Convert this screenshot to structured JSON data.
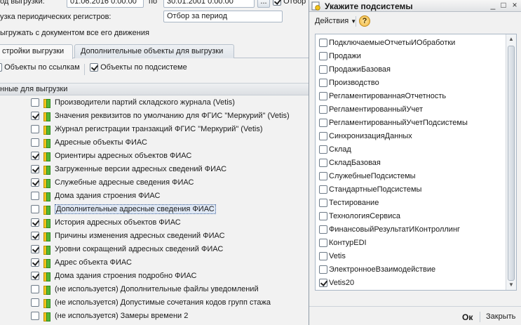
{
  "form": {
    "period_label": "од выгрузки:",
    "period_from": "01.06.2016 0:00:00",
    "period_to_label": "по",
    "period_to": "30.01.2001 0:00:00",
    "dots_label": "...",
    "period_filter_label": "Отбор",
    "periodic_registers_label": "узка периодических регистров:",
    "periodic_registers_value": "Отбор за период",
    "unload_with_doc_label": "ыгружать с документом все его движения"
  },
  "tabs": [
    {
      "label": "стройки выгрузки"
    },
    {
      "label": "Дополнительные объекты для выгрузки"
    }
  ],
  "toolbar": {
    "by_links": "Объекты по ссылкам",
    "by_subsystem": "Объекты по подсистеме"
  },
  "group_header": "нные для выгрузки",
  "tree_items": [
    {
      "label": "Производители партий складского журнала (Vetis)",
      "checked": false
    },
    {
      "label": "Значения реквизитов по умолчанию для ФГИС \"Меркурий\" (Vetis)",
      "checked": true
    },
    {
      "label": "Журнал регистрации транзакций ФГИС \"Меркурий\" (Vetis)",
      "checked": false
    },
    {
      "label": "Адресные объекты ФИАС",
      "checked": false
    },
    {
      "label": "Ориентиры адресных объектов ФИАС",
      "checked": true
    },
    {
      "label": "Загруженные версии адресных сведений ФИАС",
      "checked": true
    },
    {
      "label": "Служебные адресные сведения ФИАС",
      "checked": true
    },
    {
      "label": "Дома здания строения ФИАС",
      "checked": false
    },
    {
      "label": "Дополнительные адресные сведения ФИАС",
      "checked": false,
      "selected": true
    },
    {
      "label": "История адресных объектов ФИАС",
      "checked": true
    },
    {
      "label": "Причины изменения адресных сведений ФИАС",
      "checked": true
    },
    {
      "label": "Уровни сокращений адресных сведений ФИАС",
      "checked": true
    },
    {
      "label": "Адрес объекта ФИАС",
      "checked": true
    },
    {
      "label": "Дома здания строения подробно ФИАС",
      "checked": true
    },
    {
      "label": "(не используется) Дополнительные файлы уведомлений",
      "checked": false
    },
    {
      "label": "(не используется) Допустимые сочетания кодов групп стажа",
      "checked": false
    },
    {
      "label": "(не используется) Замеры времени 2",
      "checked": false
    }
  ],
  "dialog": {
    "title": "Укажите подсистемы",
    "actions_label": "Действия",
    "help_label": "?",
    "ok_label": "Ок",
    "close_label": "Закрыть",
    "items": [
      {
        "label": "ПодключаемыеОтчетыИОбработки",
        "checked": false
      },
      {
        "label": "Продажи",
        "checked": false
      },
      {
        "label": "ПродажиБазовая",
        "checked": false
      },
      {
        "label": "Производство",
        "checked": false
      },
      {
        "label": "РегламентированнаяОтчетность",
        "checked": false
      },
      {
        "label": "РегламентированныйУчет",
        "checked": false
      },
      {
        "label": "РегламентированныйУчетПодсистемы",
        "checked": false
      },
      {
        "label": "СинхронизацияДанных",
        "checked": false
      },
      {
        "label": "Склад",
        "checked": false
      },
      {
        "label": "СкладБазовая",
        "checked": false
      },
      {
        "label": "СлужебныеПодсистемы",
        "checked": false
      },
      {
        "label": "СтандартныеПодсистемы",
        "checked": false
      },
      {
        "label": "Тестирование",
        "checked": false
      },
      {
        "label": "ТехнологияСервиса",
        "checked": false
      },
      {
        "label": "ФинансовыйРезультатИКонтроллинг",
        "checked": false
      },
      {
        "label": "КонтурEDI",
        "checked": false
      },
      {
        "label": "Vetis",
        "checked": false
      },
      {
        "label": "ЭлектронноеВзаимодействие",
        "checked": false
      },
      {
        "label": "Vetis20",
        "checked": true
      }
    ]
  },
  "colors": {
    "selection_bg": "#dfe8f5",
    "title_bar": "#e1e3e6"
  }
}
